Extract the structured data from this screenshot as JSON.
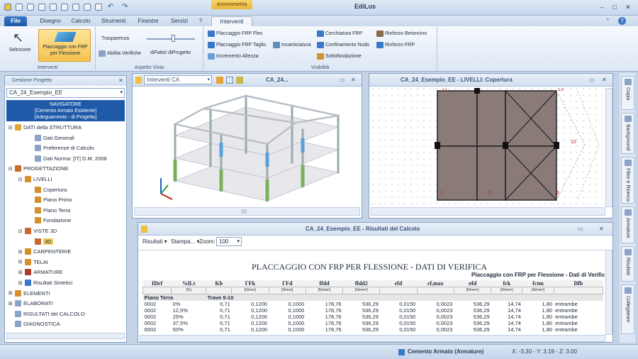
{
  "app": {
    "title": "EdiLus",
    "context_tab": "Assonometria",
    "min": "–",
    "max": "□",
    "close": "✕"
  },
  "tabs": [
    {
      "label": "File"
    },
    {
      "label": "Disegno"
    },
    {
      "label": "Calcolo"
    },
    {
      "label": "Strumenti"
    },
    {
      "label": "Finestre"
    },
    {
      "label": "Servizi"
    },
    {
      "label": "?"
    },
    {
      "label": "Interventi"
    }
  ],
  "ribbon": {
    "selezione": "Selezione",
    "placcaggio_btn": "Placcaggio con FRP per Flessione",
    "group_interventi": "Interventi",
    "trasparenza": "Trasparenza",
    "trasparenza_level": 0.55,
    "abilita_verifiche": "Abilita Verifiche",
    "di_fatto": "diFatto/ diProgetto",
    "group_aspetto": "Aspetto Vista",
    "items": [
      "Placcaggio FRP Fles",
      "Placcaggio FRP Taglio",
      "Incremento Altezza",
      "Incamiciatura",
      "Cerchiatura FRP",
      "Confinamento Nodo",
      "Sottofondazione",
      "Rinforzo Betoncino",
      "Rinforzo FRP"
    ],
    "group_visibilita": "Visibilità",
    "colors": {
      "accent": "#1f5aa8",
      "selected": "#f4cd5a"
    }
  },
  "left_panel": {
    "header": "Gestione Progetto",
    "project": "CA_24_Esempio_EE",
    "navigator": [
      "NAVIGATORE",
      "[Cemento Armato Esistente]",
      "[Adeguamento - di Progetto]"
    ],
    "tree": [
      {
        "label": "DATI della STRUTTURA",
        "level": 0,
        "exp": "⊟",
        "icon": "#e3a53a"
      },
      {
        "label": "Dati Generali",
        "level": 2,
        "exp": "",
        "icon": "#8aa3c6"
      },
      {
        "label": "Preferenze di Calcolo",
        "level": 2,
        "exp": "",
        "icon": "#8aa3c6"
      },
      {
        "label": "Dati Norma: [IT] D.M. 2008",
        "level": 2,
        "exp": "",
        "icon": "#8aa3c6"
      },
      {
        "label": "PROGETTAZIONE",
        "level": 0,
        "exp": "⊟",
        "icon": "#c96a2c"
      },
      {
        "label": "LIVELLI",
        "level": 1,
        "exp": "⊟",
        "icon": "#d3902c"
      },
      {
        "label": "Copertura",
        "level": 2,
        "exp": "",
        "icon": "#d3902c"
      },
      {
        "label": "Piano Primo",
        "level": 2,
        "exp": "",
        "icon": "#d3902c"
      },
      {
        "label": "Piano Terra",
        "level": 2,
        "exp": "",
        "icon": "#d3902c"
      },
      {
        "label": "Fondazione",
        "level": 2,
        "exp": "",
        "icon": "#d3902c"
      },
      {
        "label": "VISTE 3D",
        "level": 1,
        "exp": "⊟",
        "icon": "#c96a2c"
      },
      {
        "label": "3D",
        "level": 2,
        "exp": "",
        "icon": "#c96a2c",
        "selected": true
      },
      {
        "label": "CARPENTERIE",
        "level": 1,
        "exp": "⊞",
        "icon": "#d3902c"
      },
      {
        "label": "TELAI",
        "level": 1,
        "exp": "⊞",
        "icon": "#d3902c"
      },
      {
        "label": "ARMATURE",
        "level": 1,
        "exp": "⊞",
        "icon": "#b03a2e"
      },
      {
        "label": "Risultati Sintetici",
        "level": 1,
        "exp": "⊞",
        "icon": "#3a77c6"
      },
      {
        "label": "ELEMENTI",
        "level": 0,
        "exp": "⊞",
        "icon": "#d3902c"
      },
      {
        "label": "ELABORATI",
        "level": 0,
        "exp": "⊞",
        "icon": "#8aa3c6"
      },
      {
        "label": "RISULTATI del CALCOLO",
        "level": 0,
        "exp": "",
        "icon": "#8aa3c6"
      },
      {
        "label": "DIAGNOSTICA",
        "level": 0,
        "exp": "",
        "icon": "#8aa3c6"
      }
    ]
  },
  "view3d": {
    "dropdown": "Interventi CA",
    "title": "CA_24..."
  },
  "view2d": {
    "title": "CA_24_Esempio_EE - LIVELLI: Copertura",
    "nodes": [
      "12",
      "13",
      "10",
      "1",
      "2",
      "5"
    ]
  },
  "results": {
    "title": "CA_24_Esempio_EE - Risultati del Calcolo",
    "toolbar": {
      "risultati": "Risultati",
      "stampa": "Stampa...",
      "zoom_label": "Zoom:",
      "zoom": "100"
    },
    "report_title": "PLACCAGGIO CON FRP PER FLESSIONE - DATI DI VERIFICA",
    "report_subtitle": "Placcaggio con FRP per Flessione - Dati di Verific",
    "headers": [
      "IDrf",
      "%lLt",
      "Kb",
      "ΓFk",
      "ΓFd",
      "ffdd",
      "ffdd2",
      "εfd",
      "εf,max",
      "σfd",
      "fck",
      "fctm",
      "Dfb"
    ],
    "units": [
      "",
      "[%]",
      "",
      "[N/mm]",
      "[N/mm]",
      "[N/mm²]",
      "[N/mm²]",
      "",
      "",
      "[N/mm²]",
      "[N/mm²]",
      "[N/mm²]",
      ""
    ],
    "section_a": "Piano Terra",
    "section_b": "Trave 5-10",
    "rows": [
      [
        "0002",
        "0%",
        "0,71",
        "0,1200",
        "0,1000",
        "178,76",
        "536,29",
        "0,0150",
        "0,0023",
        "536,29",
        "14,74",
        "1,80",
        "entrambe"
      ],
      [
        "0002",
        "12,5%",
        "0,71",
        "0,1200",
        "0,1000",
        "178,76",
        "536,29",
        "0,0150",
        "0,0023",
        "536,29",
        "14,74",
        "1,80",
        "entrambe"
      ],
      [
        "0002",
        "25%",
        "0,71",
        "0,1200",
        "0,1000",
        "178,76",
        "536,29",
        "0,0150",
        "0,0023",
        "536,29",
        "14,74",
        "1,80",
        "entrambe"
      ],
      [
        "0002",
        "37,5%",
        "0,71",
        "0,1200",
        "0,1000",
        "178,76",
        "536,29",
        "0,0150",
        "0,0023",
        "536,29",
        "14,74",
        "1,80",
        "entrambe"
      ],
      [
        "0002",
        "50%",
        "0,71",
        "0,1200",
        "0,1000",
        "178,76",
        "536,29",
        "0,0150",
        "0,0023",
        "536,29",
        "14,74",
        "1,80",
        "entrambe"
      ]
    ]
  },
  "right_bar": [
    "Copia",
    "Background",
    "Filtro e Ricerca",
    "Armature",
    "Risultati",
    "Collegamen"
  ],
  "status": {
    "mode": "Cemento Armato (Armature)",
    "coords": "X: -3.30 - Y: 3.19 - Z: 3.00"
  }
}
